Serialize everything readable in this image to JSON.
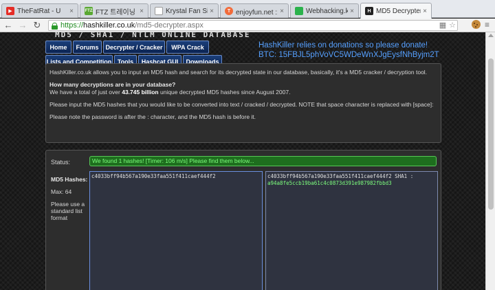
{
  "browser": {
    "tabs": [
      {
        "title": "TheFatRat - U",
        "icon": "youtube-icon",
        "color": "#e52d27",
        "glyph": "▶"
      },
      {
        "title": "FTZ 트레이닝 총",
        "icon": "ftz-icon",
        "color": "#5aa832",
        "glyph": "FTZ"
      },
      {
        "title": "Krystal Fan Site",
        "icon": "page-icon",
        "color": "#9e9e9e",
        "glyph": ""
      },
      {
        "title": "enjoyfun.net :: 인",
        "icon": "tistory-icon",
        "color": "#f26b3a",
        "glyph": "T"
      },
      {
        "title": "Webhacking.kr",
        "icon": "webhacking-icon",
        "color": "#2bb24c",
        "glyph": "■"
      },
      {
        "title": "MD5 Decrypter -",
        "icon": "hashkiller-icon",
        "color": "#222222",
        "glyph": "H"
      }
    ],
    "url_scheme": "https://",
    "url_host": "hashkiller.co.uk",
    "url_path": "/md5-decrypter.aspx"
  },
  "site": {
    "logo_text": "MD5 / SHA1 / NTLM ONLINE DATABASE",
    "nav": [
      {
        "label": "Home"
      },
      {
        "label": "Forums"
      },
      {
        "label": "Decrypter / Cracker"
      },
      {
        "label": "WPA Crack"
      },
      {
        "label": "Lists and Competition"
      },
      {
        "label": "Tools"
      },
      {
        "label": "Hashcat GUI"
      },
      {
        "label": "Downloads"
      }
    ],
    "donate_line1": "HashKiller relies on donations so please donate!",
    "donate_line2": "BTC: 15FBJL5phVoVC5WDeWnXJgEysfNhByjm2T",
    "accent": "#56a0ff"
  },
  "info": {
    "intro": "HashKiller.co.uk allows you to input an MD5 hash and search for its decrypted state in our database, basically, it's a MD5 cracker / decryption tool.",
    "question": "How many decryptions are in your database?",
    "count_prefix": "We have a total of just over ",
    "count_value": "43.745 billion",
    "count_suffix": " unique decrypted MD5 hashes since August 2007.",
    "instructions": "Please input the MD5 hashes that you would like to be converted into text / cracked / decrypted. NOTE that space character is replaced with [space]:",
    "note": "Please note the password is after the : character, and the MD5 hash is before it."
  },
  "form": {
    "status_label": "Status:",
    "status_text": "We found 1 hashes! [Timer: 106 m/s] Please find them below...",
    "hashes_label": "MD5 Hashes:",
    "max_label": "Max: 64",
    "format_hint": "Please use a standard list format",
    "input_value": "c4033bff94b567a190e33faa551f411caef444f2",
    "output_hash": "c4033bff94b567a190e33faa551f411caef444f2 SHA1 :",
    "output_plain": "a94a8fe5ccb19ba61c4c0873d391e987982fbbd3",
    "status_color": "#57c957"
  }
}
